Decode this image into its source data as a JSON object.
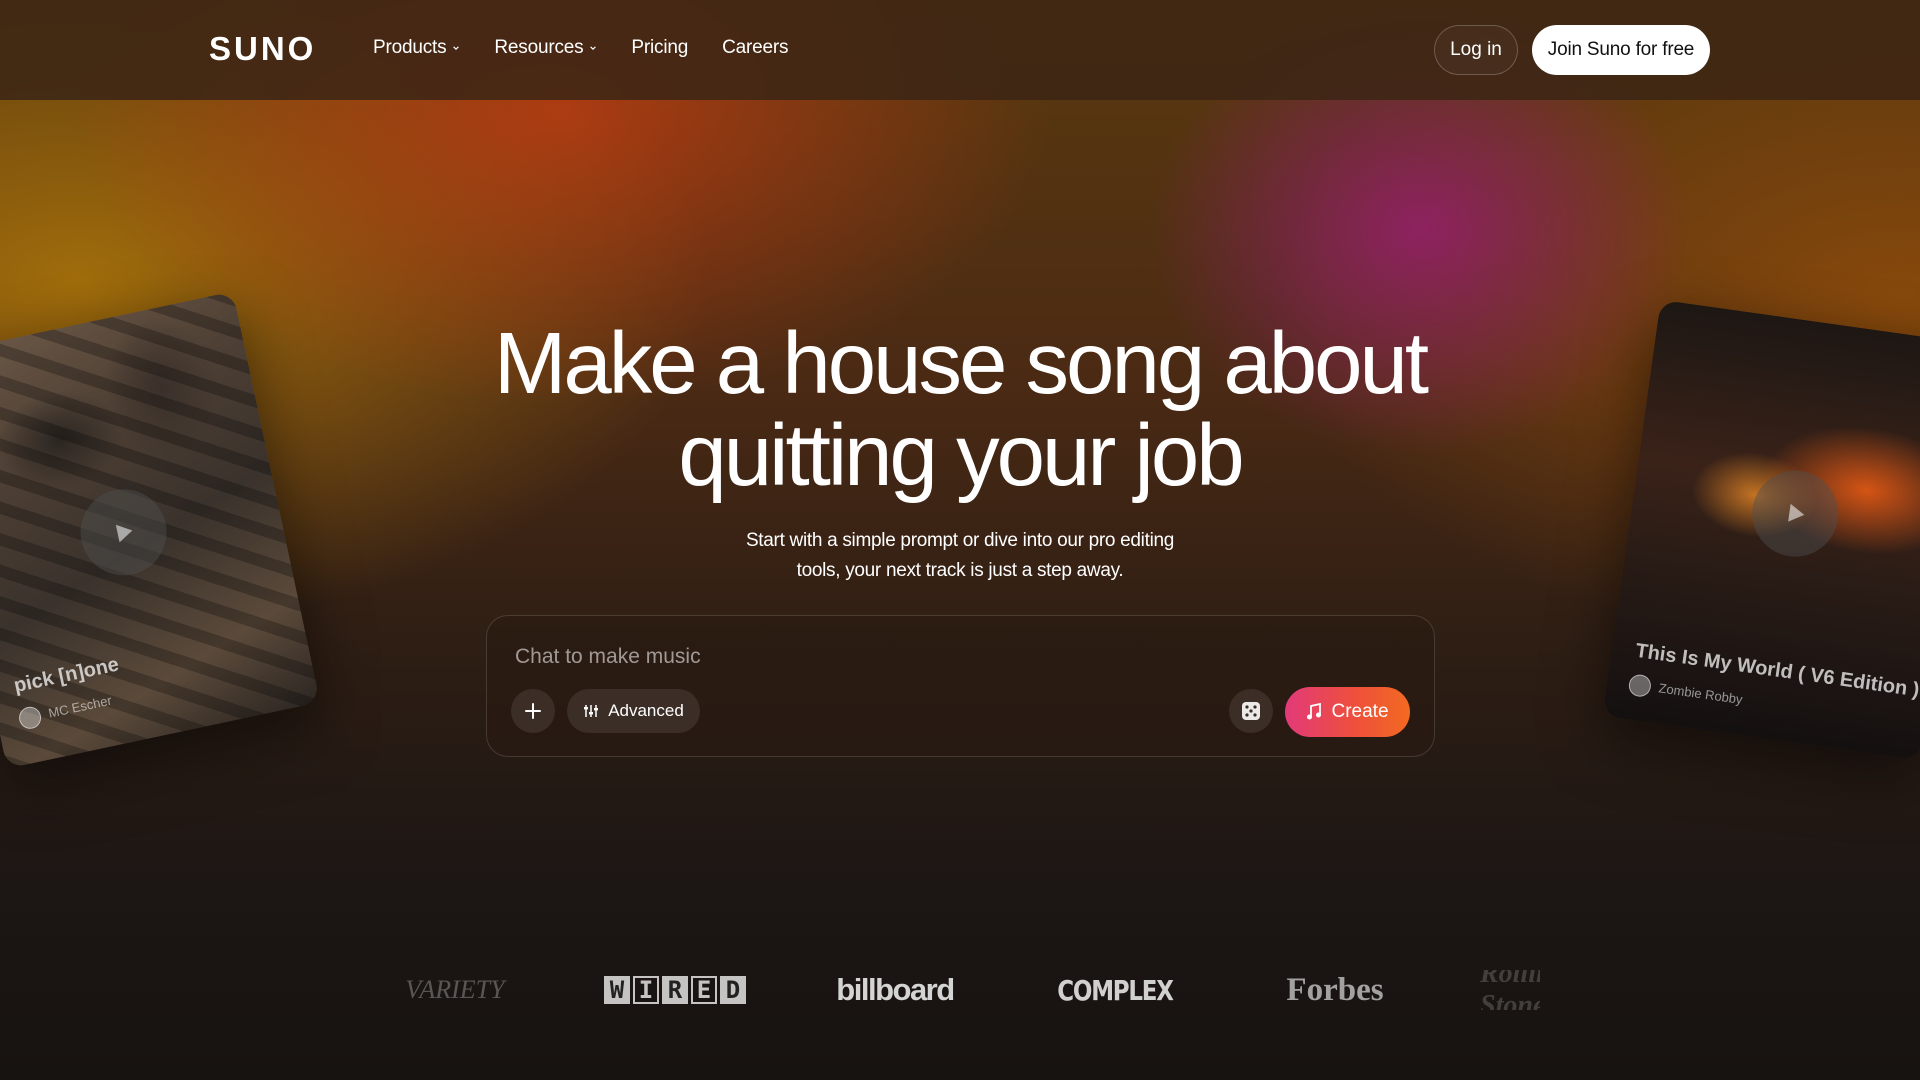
{
  "header": {
    "logo": "SUNO",
    "nav": [
      {
        "label": "Products",
        "has_dropdown": true
      },
      {
        "label": "Resources",
        "has_dropdown": true
      },
      {
        "label": "Pricing",
        "has_dropdown": false
      },
      {
        "label": "Careers",
        "has_dropdown": false
      }
    ],
    "login_label": "Log in",
    "join_label": "Join Suno for free"
  },
  "hero": {
    "title_line1": "Make a house song about",
    "title_line2": "quitting your job",
    "subtitle_line1": "Start with a simple prompt or dive into our pro editing",
    "subtitle_line2": "tools, your next track is just a step away."
  },
  "prompt": {
    "placeholder": "Chat to make music",
    "value": "",
    "add_icon": "plus-icon",
    "advanced_label": "Advanced",
    "advanced_icon": "sliders-icon",
    "random_icon": "dice-icon",
    "create_label": "Create",
    "create_icon": "music-note-icon"
  },
  "featured_tracks": [
    {
      "title": "pick [n]one",
      "artist": "MC Escher"
    },
    {
      "title": "This Is My World ( V6 Edition )",
      "artist": "Zombie Robby"
    }
  ],
  "press": [
    "VARIETY",
    "WIRED",
    "billboard",
    "COMPLEX",
    "Forbes",
    "Rolling Stone"
  ],
  "colors": {
    "create_gradient_start": "#e23a7a",
    "create_gradient_end": "#f26a21",
    "join_button_bg": "#ffffff"
  }
}
